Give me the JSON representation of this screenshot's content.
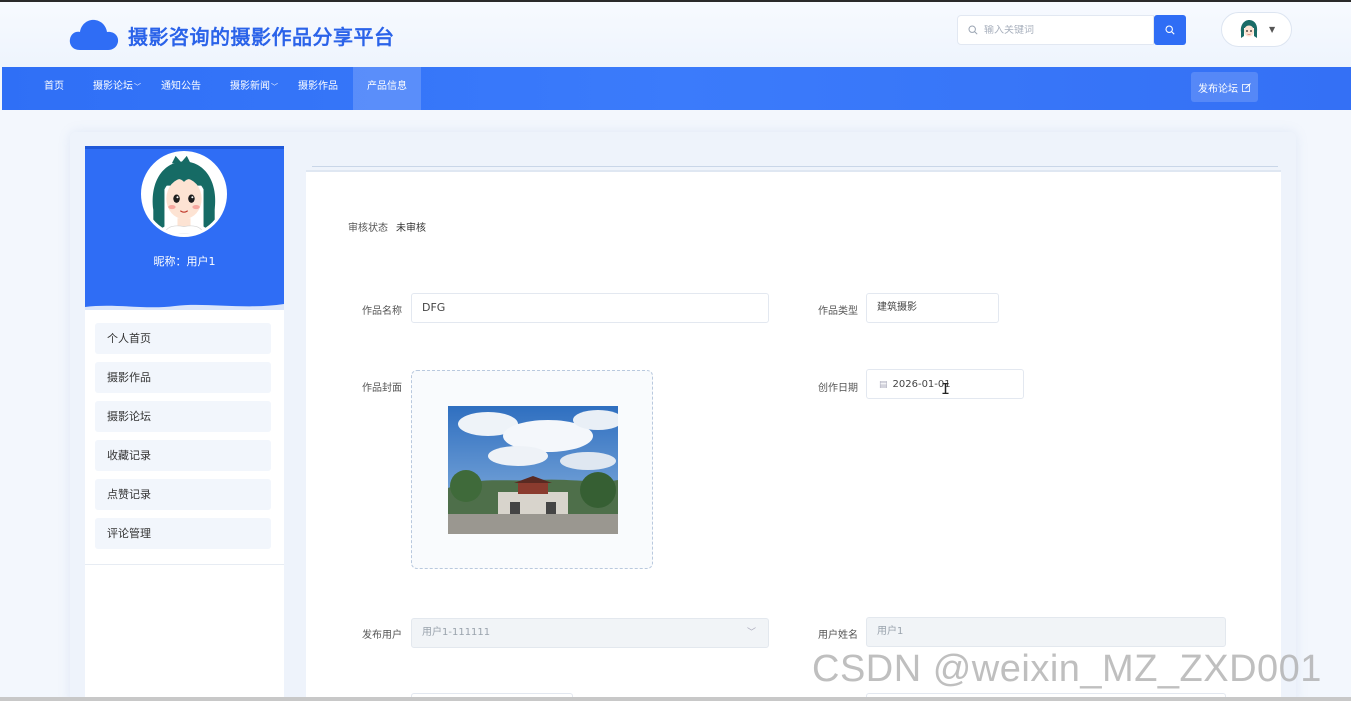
{
  "site": {
    "title": "摄影咨询的摄影作品分享平台"
  },
  "search": {
    "placeholder": "输入关键词"
  },
  "nav": {
    "items": [
      {
        "label": "首页"
      },
      {
        "label": "摄影论坛",
        "dropdown": true
      },
      {
        "label": "通知公告"
      },
      {
        "label": "摄影新闻",
        "dropdown": true
      },
      {
        "label": "摄影作品"
      },
      {
        "label": "产品信息",
        "active": true
      }
    ],
    "publish_label": "发布论坛"
  },
  "profile": {
    "nickname": "昵称：用户1"
  },
  "sidebar": {
    "items": [
      {
        "label": "个人首页"
      },
      {
        "label": "摄影作品"
      },
      {
        "label": "摄影论坛"
      },
      {
        "label": "收藏记录"
      },
      {
        "label": "点赞记录"
      },
      {
        "label": "评论管理"
      }
    ]
  },
  "form": {
    "review_status_label": "审核状态",
    "review_status_value": "未审核",
    "work_name_label": "作品名称",
    "work_name_value": "DFG",
    "work_type_label": "作品类型",
    "work_type_value": "建筑摄影",
    "cover_label": "作品封面",
    "date_label": "创作日期",
    "date_value": "2026-01-01",
    "publisher_label": "发布用户",
    "publisher_value": "用户1-111111",
    "username_label": "用户姓名",
    "username_value": "用户1"
  },
  "watermark": "CSDN @weixin_MZ_ZXD001",
  "colors": {
    "primary": "#2f6df5",
    "nav": "#3374f8",
    "title": "#2b63e9"
  }
}
